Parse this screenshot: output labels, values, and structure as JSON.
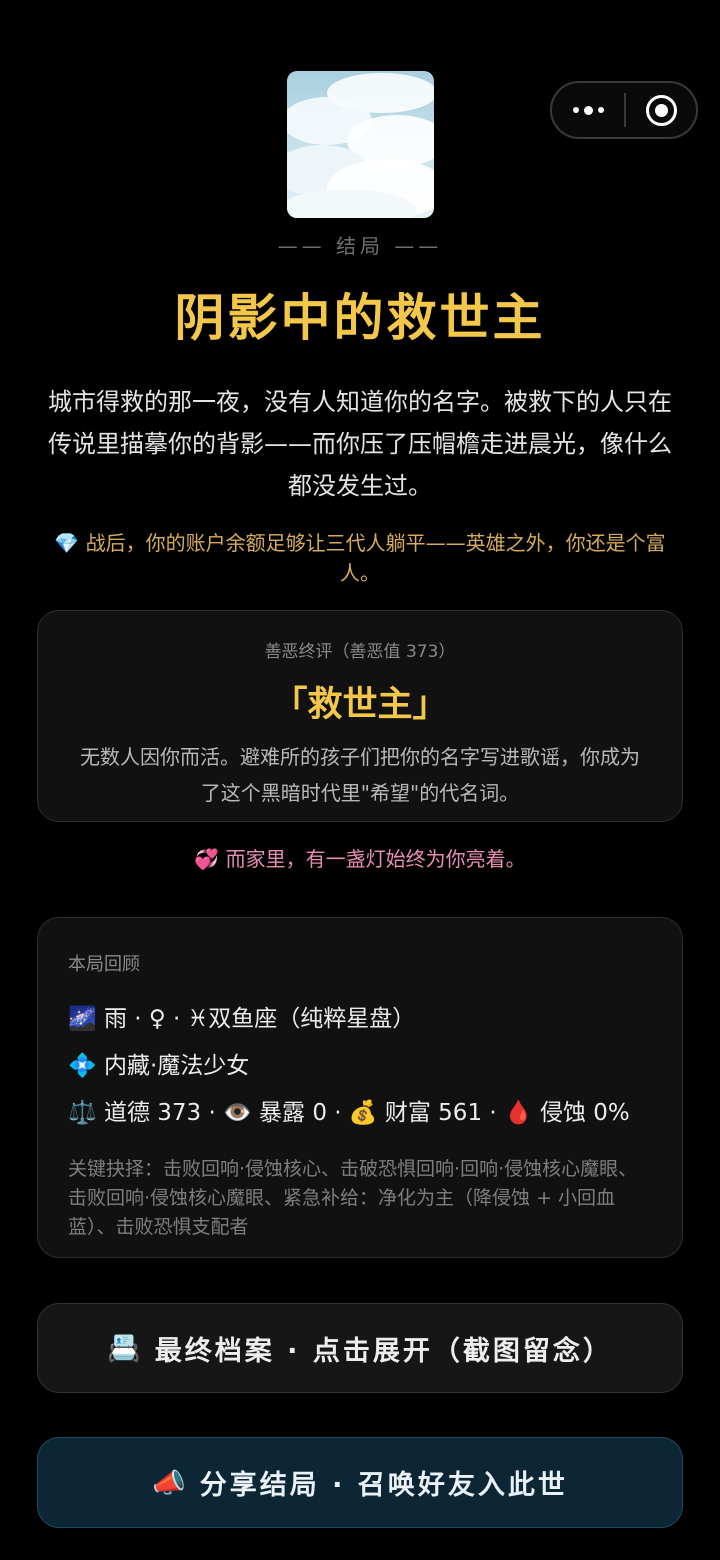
{
  "capsule": {
    "more_icon": "more-dots-icon",
    "close_icon": "target-icon"
  },
  "ending": {
    "label": "—— 结局 ——",
    "title": "阴影中的救世主",
    "story": "城市得救的那一夜，没有人知道你的名字。被救下的人只在传说里描摹你的背影——而你压了压帽檐走进晨光，像什么都没发生过。",
    "wealth_note": "💎 战后，你的账户余额足够让三代人躺平——英雄之外，你还是个富人。"
  },
  "verdict": {
    "caption": "善恶终评（善恶值 373）",
    "rank": "「救世主」",
    "description": "无数人因你而活。避难所的孩子们把你的名字写进歌谣，你成为了这个黑暗时代里\"希望\"的代名词。"
  },
  "family_note": "💞 而家里，有一盏灯始终为你亮着。",
  "recap": {
    "heading": "本局回顾",
    "identity": "🌌 雨 · ♀ · ♓双鱼座（纯粹星盘）",
    "hidden_role": "💠 内藏·魔法少女",
    "stats": "⚖️ 道德 373 · 👁️ 暴露 0 · 💰 财富 561 · 🩸 侵蚀 0%",
    "key_choices": "关键抉择：击败回响·侵蚀核心、击破恐惧回响·回响·侵蚀核心魔眼、击败回响·侵蚀核心魔眼、紧急补给：净化为主（降侵蚀 + 小回血蓝）、击败恐惧支配者"
  },
  "buttons": {
    "archive_icon": "📇",
    "archive_label": "最终档案 · 点击展开（截图留念）",
    "share_icon": "📣",
    "share_label": "分享结局 · 召唤好友入此世"
  },
  "colors": {
    "accent_gold": "#f3c74a",
    "wealth_gold": "#d6ac5a",
    "family_pink": "#e78db4",
    "share_bg": "#0c2636"
  }
}
